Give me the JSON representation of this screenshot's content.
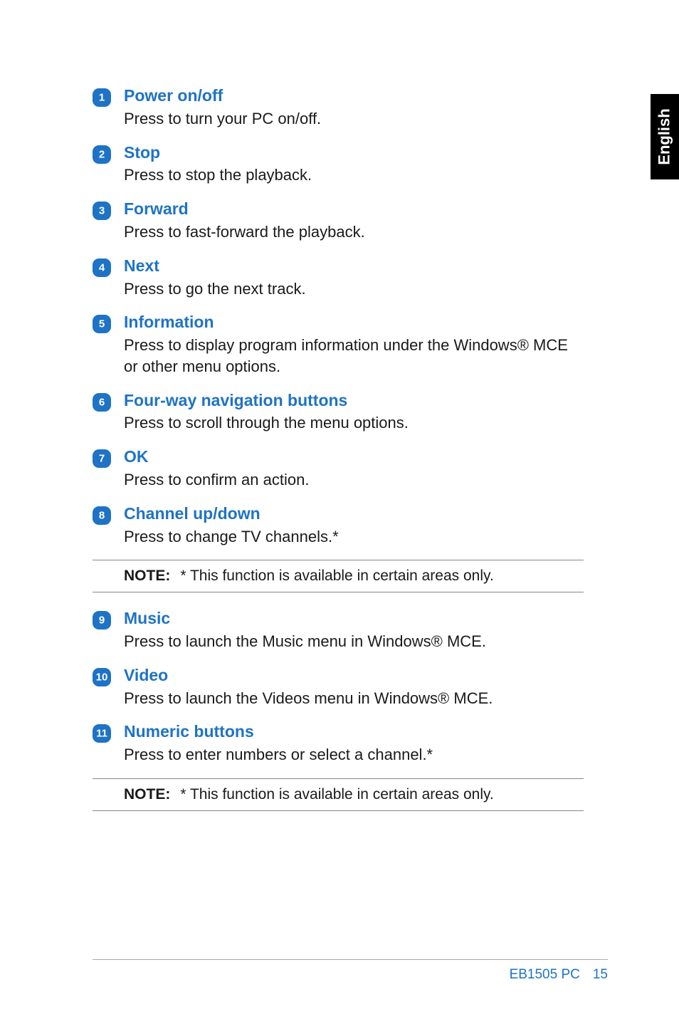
{
  "language_tab": "English",
  "items": [
    {
      "num": "1",
      "title": "Power on/off",
      "desc": "Press to turn your PC on/off."
    },
    {
      "num": "2",
      "title": "Stop",
      "desc": "Press to stop the playback."
    },
    {
      "num": "3",
      "title": "Forward",
      "desc": "Press to fast-forward the playback."
    },
    {
      "num": "4",
      "title": "Next",
      "desc": "Press to go the next track."
    },
    {
      "num": "5",
      "title": "Information",
      "desc": "Press to display program information under the Windows® MCE or other menu options."
    },
    {
      "num": "6",
      "title": "Four-way navigation buttons",
      "desc": "Press to scroll through the menu options."
    },
    {
      "num": "7",
      "title": "OK",
      "desc": "Press to confirm an action."
    },
    {
      "num": "8",
      "title": "Channel up/down",
      "desc": "Press to change TV channels.*"
    }
  ],
  "note1": {
    "label": "NOTE:",
    "text": "* This function is available in certain areas only."
  },
  "items2": [
    {
      "num": "9",
      "title": "Music",
      "desc": "Press to launch the Music menu in Windows® MCE."
    },
    {
      "num": "10",
      "title": "Video",
      "desc": "Press to launch the Videos menu in Windows® MCE."
    },
    {
      "num": "11",
      "title": "Numeric buttons",
      "desc": "Press to enter numbers or select a channel.*"
    }
  ],
  "note2": {
    "label": "NOTE:",
    "text": "* This function is available in certain areas only."
  },
  "footer": {
    "model": "EB1505 PC",
    "page": "15"
  }
}
